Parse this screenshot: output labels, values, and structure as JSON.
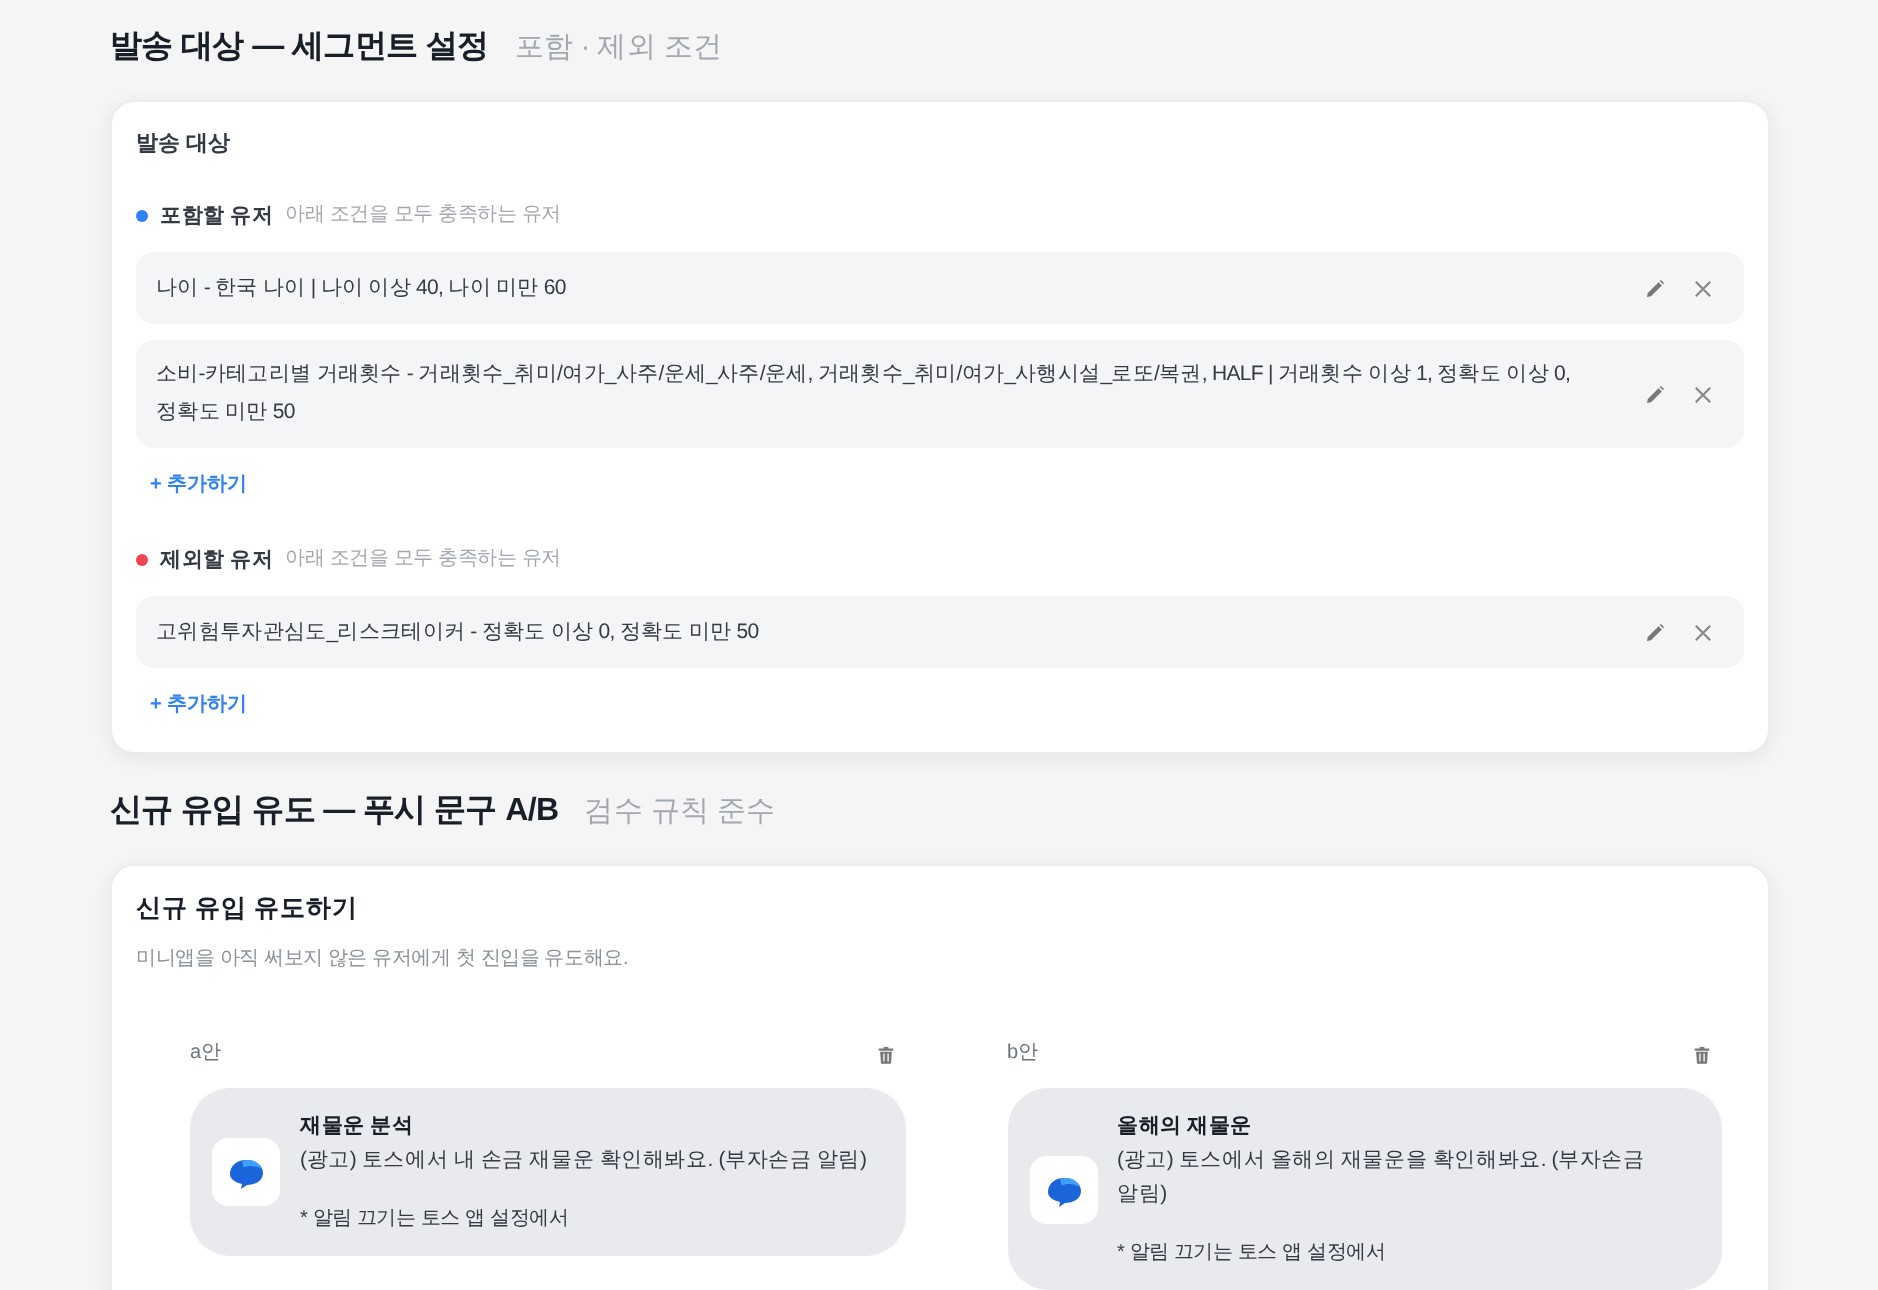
{
  "segment_section": {
    "title": "발송 대상 — 세그먼트 설정",
    "subtitle": "포함 · 제외 조건",
    "card": {
      "title": "발송 대상",
      "groups": [
        {
          "label": "포함할 유저",
          "hint": "아래 조건을 모두 충족하는 유저",
          "color": "#3182f6",
          "conditions": [
            "나이 - 한국 나이 | 나이 이상 40, 나이 미만 60",
            "소비-카테고리별 거래횟수 - 거래횟수_취미/여가_사주/운세_사주/운세, 거래횟수_취미/여가_사행시설_로또/복권, HALF | 거래횟수 이상 1, 정확도 이상 0, 정확도 미만 50"
          ],
          "add_link": "+ 추가하기"
        },
        {
          "label": "제외할 유저",
          "hint": "아래 조건을 모두 충족하는 유저",
          "color": "#f04452",
          "conditions": [
            "고위험투자관심도_리스크테이커 - 정확도 이상 0, 정확도 미만 50"
          ],
          "add_link": "+ 추가하기"
        }
      ]
    }
  },
  "push_section": {
    "title": "신규 유입 유도 — 푸시 문구 A/B",
    "subtitle": "검수 규칙 준수",
    "card": {
      "title": "신규 유입 유도하기",
      "description": "미니앱을 아직 써보지 않은 유저에게 첫 진입을 유도해요.",
      "variants": [
        {
          "label": "a안",
          "preview": {
            "title": "재물운 분석",
            "body": "(광고) 토스에서 내 손금 재물운 확인해봐요. (부자손금 알림)",
            "note": "* 알림 끄기는 토스 앱 설정에서"
          }
        },
        {
          "label": "b안",
          "preview": {
            "title": "올해의 재물운",
            "body": "(광고) 토스에서 올해의 재물운을 확인해봐요. (부자손금 알림)",
            "note": "* 알림 끄기는 토스 앱 설정에서"
          }
        }
      ]
    }
  }
}
